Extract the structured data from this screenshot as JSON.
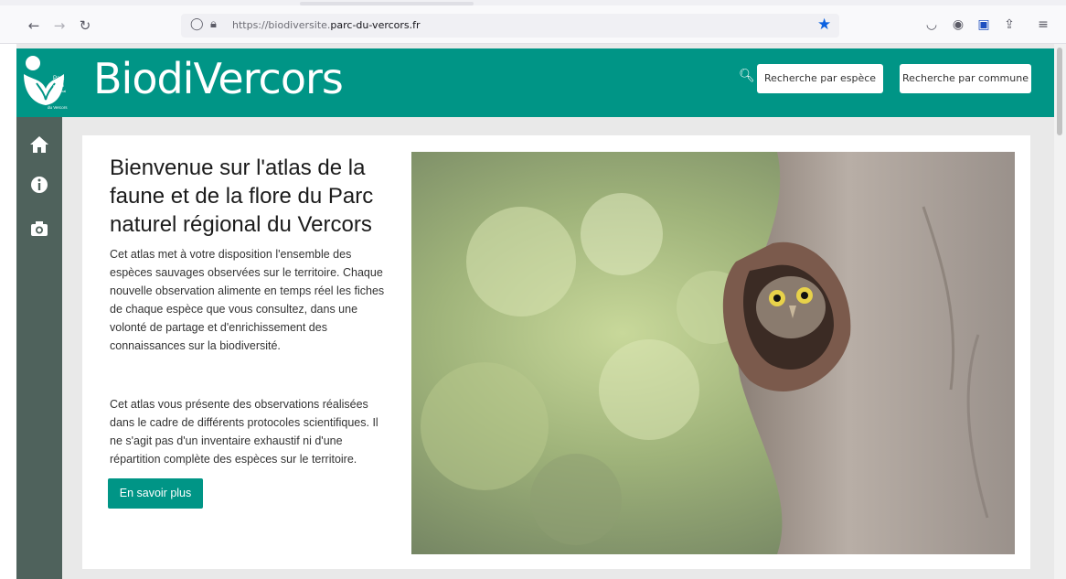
{
  "browser": {
    "url_prefix": "https://biodiversite.",
    "url_domain": "parc-du-vercors.fr",
    "icons": [
      "back-icon",
      "forward-icon",
      "reload-icon",
      "shield-icon",
      "lock-icon",
      "bookmark-star-icon",
      "pocket-icon",
      "account-icon",
      "extension-icon",
      "share-icon",
      "menu-icon"
    ]
  },
  "header": {
    "logo_text": "Parc naturel régional du Vercors",
    "brand": "BiodiVercors",
    "search_species": "Recherche par espèce",
    "search_commune": "Recherche par commune",
    "accent_color": "#009586"
  },
  "sidebar": {
    "icons": [
      "home-icon",
      "info-icon",
      "camera-icon"
    ],
    "color": "#4f625c"
  },
  "main": {
    "title": "Bienvenue sur l'atlas de la faune et de la flore du Parc naturel régional du Vercors",
    "paragraph1": "Cet atlas met à votre disposition l'ensemble des espèces sauvages observées sur le territoire. Chaque nouvelle observation alimente en temps réel les fiches de chaque espèce que vous consultez, dans une volonté de partage et d'enrichissement des connaissances sur la biodiversité.",
    "paragraph2": "Cet atlas vous présente des observations réalisées dans le cadre de différents protocoles scientifiques. Il ne s'agit pas d'un inventaire exhaustif ni d'une répartition complète des espèces sur le territoire.",
    "button": "En savoir plus",
    "image_subject": "owl in tree hollow"
  }
}
